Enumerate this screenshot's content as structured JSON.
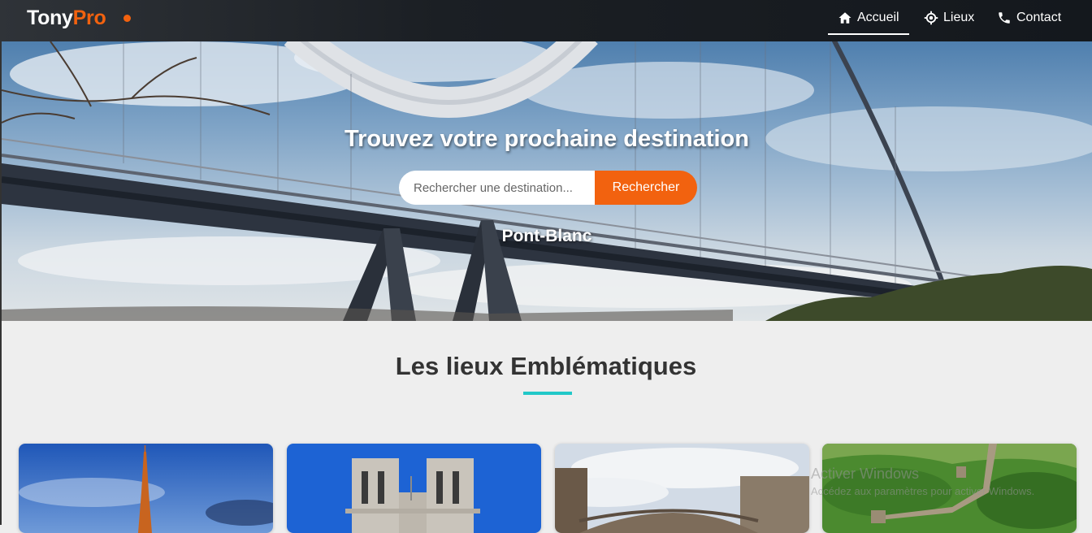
{
  "nav": {
    "logo_main": "Tony",
    "logo_accent": "Pro",
    "items": [
      {
        "label": "Accueil",
        "icon": "home-icon",
        "active": true
      },
      {
        "label": "Lieux",
        "icon": "location-icon",
        "active": false
      },
      {
        "label": "Contact",
        "icon": "phone-icon",
        "active": false
      }
    ]
  },
  "hero": {
    "title": "Trouvez votre prochaine destination",
    "search_placeholder": "Rechercher une destination...",
    "search_button": "Rechercher",
    "place_name": "Pont-Blanc"
  },
  "section": {
    "title": "Les lieux Emblématiques"
  },
  "cards": [
    {
      "name": "card-eiffel-tower"
    },
    {
      "name": "card-notre-dame"
    },
    {
      "name": "card-old-bridge"
    },
    {
      "name": "card-great-wall"
    }
  ],
  "watermark": {
    "line1": "Activer Windows",
    "line2": "Accédez aux paramètres pour activer Windows."
  },
  "colors": {
    "accent": "#f2620f",
    "underline": "#21c8c8",
    "nav_bg": "#1b1f24"
  }
}
